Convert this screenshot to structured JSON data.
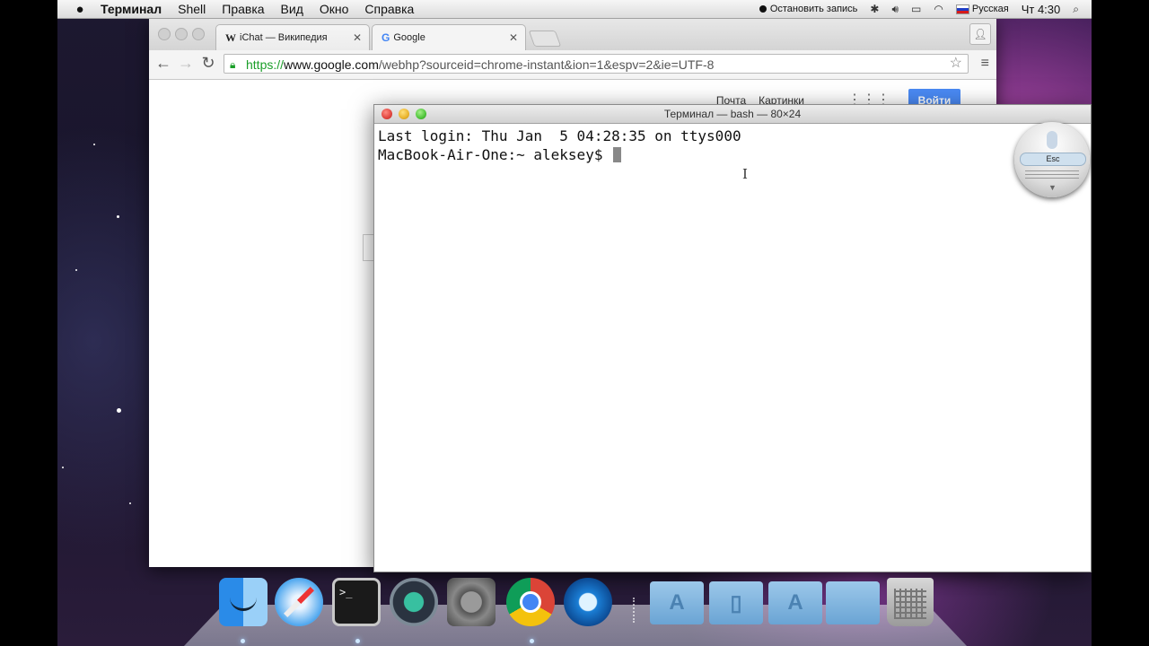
{
  "menubar": {
    "app_name": "Терминал",
    "items": [
      "Shell",
      "Правка",
      "Вид",
      "Окно",
      "Справка"
    ],
    "recording": "Остановить запись",
    "input_source": "Русская",
    "clock": "Чт 4:30"
  },
  "browser": {
    "tabs": [
      {
        "favicon": "W",
        "label": "iChat — Википедия"
      },
      {
        "favicon": "G",
        "label": "Google"
      }
    ],
    "url_scheme": "https://",
    "url_host": "www.google.com",
    "url_path": "/webhp?sourceid=chrome-instant&ion=1&espv=2&ie=UTF-8",
    "page": {
      "links": [
        "Почта",
        "Картинки"
      ],
      "login_button": "Войти"
    }
  },
  "terminal": {
    "title": "Терминал — bash — 80×24",
    "lines": [
      "Last login: Thu Jan  5 04:28:35 on ttys000",
      "MacBook-Air-One:~ aleksey$ "
    ]
  },
  "dictation": {
    "esc_label": "Esc"
  },
  "dock": {
    "apps": [
      "finder-icon",
      "safari-icon",
      "terminal-icon",
      "time-machine-icon",
      "system-preferences-icon",
      "chrome-icon",
      "quicktime-icon"
    ],
    "terminal_glyph": ">_",
    "stacks": [
      "applications-folder-icon",
      "documents-folder-icon",
      "downloads-folder-icon",
      "folder-icon",
      "trash-icon"
    ]
  },
  "colors": {
    "url_secure": "#1a9e28",
    "login_button": "#4a8af4"
  }
}
